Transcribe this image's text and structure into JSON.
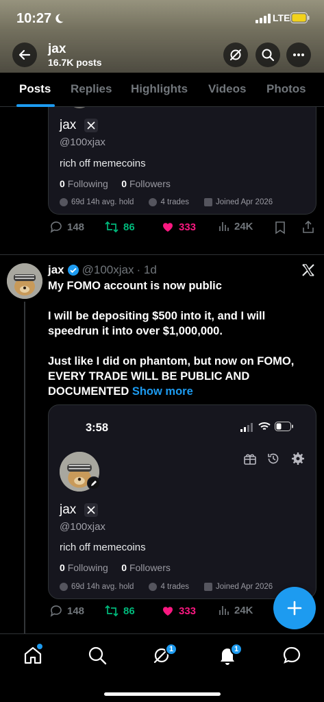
{
  "status_bar": {
    "time": "10:27",
    "network": "LTE"
  },
  "header": {
    "name": "jax",
    "posts": "16.7K posts"
  },
  "tabs": [
    {
      "label": "Posts"
    },
    {
      "label": "Replies"
    },
    {
      "label": "Highlights"
    },
    {
      "label": "Videos"
    },
    {
      "label": "Photos"
    }
  ],
  "card1": {
    "name": "jax",
    "handle": "@100xjax",
    "bio": "rich off memecoins",
    "following_count": "0",
    "following_label": "Following",
    "followers_count": "0",
    "followers_label": "Followers",
    "avg_hold": "69d 14h avg. hold",
    "trades": "4 trades",
    "joined": "Joined Apr 2026"
  },
  "actions1": {
    "replies": "148",
    "retweets": "86",
    "likes": "333",
    "views": "24K"
  },
  "tweet": {
    "name": "jax",
    "handle": "@100xjax",
    "time": "· 1d",
    "para1": "My FOMO account is now public",
    "para2": "I will be depositing $500 into it, and I will speedrun it into over $1,000,000.",
    "para3": "Just like I did on phantom, but now on FOMO, EVERY TRADE WILL BE PUBLIC AND DOCUMENTED",
    "show_more": "Show more"
  },
  "card2": {
    "phone_time": "3:58",
    "name": "jax",
    "handle": "@100xjax",
    "bio": "rich off memecoins",
    "following_count": "0",
    "following_label": "Following",
    "followers_count": "0",
    "followers_label": "Followers",
    "avg_hold": "69d 14h avg. hold",
    "trades": "4 trades",
    "joined": "Joined Apr 2026"
  },
  "actions2": {
    "replies": "148",
    "retweets": "86",
    "likes": "333",
    "views": "24K"
  },
  "bottom_nav": {
    "grok_badge": "1",
    "notifications_badge": "1"
  },
  "colors": {
    "accent": "#1d9bf0",
    "like": "#f91880",
    "retweet": "#00ba7c",
    "muted": "#71767b"
  }
}
